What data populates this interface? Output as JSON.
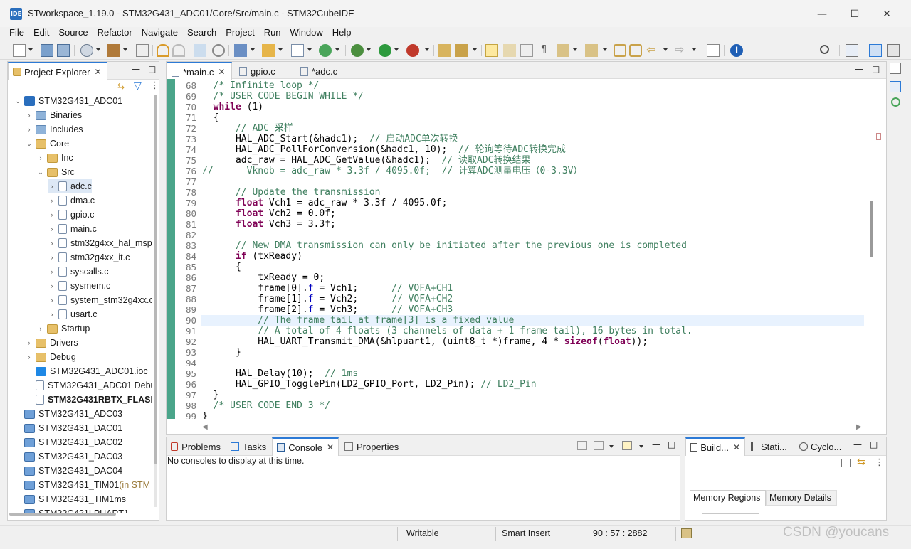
{
  "window": {
    "title": "STworkspace_1.19.0 - STM32G431_ADC01/Core/Src/main.c - STM32CubeIDE",
    "logo": "IDE"
  },
  "menu": [
    "File",
    "Edit",
    "Source",
    "Refactor",
    "Navigate",
    "Search",
    "Project",
    "Run",
    "Window",
    "Help"
  ],
  "explorer": {
    "tab": "Project Explorer",
    "rows": [
      {
        "label": "STM32G431_ADC01",
        "indent": 0,
        "chev": "v",
        "icon": "proj"
      },
      {
        "label": "Binaries",
        "indent": 1,
        "chev": ">",
        "icon": "blue"
      },
      {
        "label": "Includes",
        "indent": 1,
        "chev": ">",
        "icon": "blue"
      },
      {
        "label": "Core",
        "indent": 1,
        "chev": "v",
        "icon": "folder"
      },
      {
        "label": "Inc",
        "indent": 2,
        "chev": ">",
        "icon": "folder"
      },
      {
        "label": "Src",
        "indent": 2,
        "chev": "v",
        "icon": "folder"
      },
      {
        "label": "adc.c",
        "indent": 3,
        "chev": ">",
        "icon": "file",
        "selected": true
      },
      {
        "label": "dma.c",
        "indent": 3,
        "chev": ">",
        "icon": "file"
      },
      {
        "label": "gpio.c",
        "indent": 3,
        "chev": ">",
        "icon": "file"
      },
      {
        "label": "main.c",
        "indent": 3,
        "chev": ">",
        "icon": "file"
      },
      {
        "label": "stm32g4xx_hal_msp",
        "indent": 3,
        "chev": ">",
        "icon": "file"
      },
      {
        "label": "stm32g4xx_it.c",
        "indent": 3,
        "chev": ">",
        "icon": "file"
      },
      {
        "label": "syscalls.c",
        "indent": 3,
        "chev": ">",
        "icon": "file"
      },
      {
        "label": "sysmem.c",
        "indent": 3,
        "chev": ">",
        "icon": "file"
      },
      {
        "label": "system_stm32g4xx.c",
        "indent": 3,
        "chev": ">",
        "icon": "file"
      },
      {
        "label": "usart.c",
        "indent": 3,
        "chev": ">",
        "icon": "file"
      },
      {
        "label": "Startup",
        "indent": 2,
        "chev": ">",
        "icon": "folder"
      },
      {
        "label": "Drivers",
        "indent": 1,
        "chev": ">",
        "icon": "folder"
      },
      {
        "label": "Debug",
        "indent": 1,
        "chev": ">",
        "icon": "folder"
      },
      {
        "label": "STM32G431_ADC01.ioc",
        "indent": 1,
        "chev": "",
        "icon": "mx"
      },
      {
        "label": "STM32G431_ADC01 Debu",
        "indent": 1,
        "chev": "",
        "icon": "file"
      },
      {
        "label": "STM32G431RBTX_FLASH",
        "indent": 1,
        "chev": "",
        "icon": "file",
        "bold": true
      },
      {
        "label": "STM32G431_ADC03",
        "indent": 0,
        "chev": "",
        "icon": "proj2"
      },
      {
        "label": "STM32G431_DAC01",
        "indent": 0,
        "chev": "",
        "icon": "proj2"
      },
      {
        "label": "STM32G431_DAC02",
        "indent": 0,
        "chev": "",
        "icon": "proj2"
      },
      {
        "label": "STM32G431_DAC03",
        "indent": 0,
        "chev": "",
        "icon": "proj2"
      },
      {
        "label": "STM32G431_DAC04",
        "indent": 0,
        "chev": "",
        "icon": "proj2"
      },
      {
        "label": "STM32G431_TIM01",
        "indent": 0,
        "chev": "",
        "icon": "proj2",
        "suffix": " (in STM"
      },
      {
        "label": "STM32G431_TIM1ms",
        "indent": 0,
        "chev": "",
        "icon": "proj2"
      },
      {
        "label": "STM32G431LPUART1",
        "indent": 0,
        "chev": "",
        "icon": "proj2"
      }
    ]
  },
  "editor": {
    "tabs": [
      "*main.c",
      "gpio.c",
      "*adc.c"
    ],
    "lines": [
      {
        "n": "68",
        "t": [
          [
            "c",
            "  /* Infinite loop */"
          ]
        ]
      },
      {
        "n": "69",
        "t": [
          [
            "c",
            "  /* USER CODE BEGIN WHILE */"
          ]
        ]
      },
      {
        "n": "70",
        "t": [
          [
            "t",
            "  "
          ],
          [
            "k",
            "while"
          ],
          [
            "t",
            " (1)"
          ]
        ]
      },
      {
        "n": "71",
        "t": [
          [
            "t",
            "  {"
          ]
        ]
      },
      {
        "n": "72",
        "t": [
          [
            "c",
            "      // ADC 采样"
          ]
        ]
      },
      {
        "n": "73",
        "t": [
          [
            "t",
            "      HAL_ADC_Start(&hadc1);  "
          ],
          [
            "c",
            "// 启动ADC单次转换"
          ]
        ]
      },
      {
        "n": "74",
        "t": [
          [
            "t",
            "      HAL_ADC_PollForConversion(&hadc1, 10);  "
          ],
          [
            "c",
            "// 轮询等待ADC转换完成"
          ]
        ]
      },
      {
        "n": "75",
        "t": [
          [
            "t",
            "      adc_raw = HAL_ADC_GetValue(&hadc1);  "
          ],
          [
            "c",
            "// 读取ADC转换结果"
          ]
        ]
      },
      {
        "n": "76",
        "t": [
          [
            "c",
            "//      Vknob = adc_raw * 3.3f / 4095.0f;  // 计算ADC测量电压（0-3.3V）"
          ]
        ]
      },
      {
        "n": "77",
        "t": [
          [
            "t",
            ""
          ]
        ]
      },
      {
        "n": "78",
        "t": [
          [
            "c",
            "      // Update the transmission"
          ]
        ]
      },
      {
        "n": "79",
        "t": [
          [
            "t",
            "      "
          ],
          [
            "k",
            "float"
          ],
          [
            "t",
            " Vch1 = adc_raw * 3.3f / 4095.0f;"
          ]
        ]
      },
      {
        "n": "80",
        "t": [
          [
            "t",
            "      "
          ],
          [
            "k",
            "float"
          ],
          [
            "t",
            " Vch2 = 0.0f;"
          ]
        ]
      },
      {
        "n": "81",
        "t": [
          [
            "t",
            "      "
          ],
          [
            "k",
            "float"
          ],
          [
            "t",
            " Vch3 = 3.3f;"
          ]
        ]
      },
      {
        "n": "82",
        "t": [
          [
            "t",
            ""
          ]
        ]
      },
      {
        "n": "83",
        "t": [
          [
            "c",
            "      // New DMA transmission can only be initiated after the previous one is completed"
          ]
        ]
      },
      {
        "n": "84",
        "t": [
          [
            "t",
            "      "
          ],
          [
            "k",
            "if"
          ],
          [
            "t",
            " (txReady)"
          ]
        ]
      },
      {
        "n": "85",
        "t": [
          [
            "t",
            "      {"
          ]
        ]
      },
      {
        "n": "86",
        "t": [
          [
            "t",
            "          txReady = 0;"
          ]
        ]
      },
      {
        "n": "87",
        "t": [
          [
            "t",
            "          frame[0]."
          ],
          [
            "f",
            "f"
          ],
          [
            "t",
            " = Vch1;      "
          ],
          [
            "c",
            "// VOFA+CH1"
          ]
        ]
      },
      {
        "n": "88",
        "t": [
          [
            "t",
            "          frame[1]."
          ],
          [
            "f",
            "f"
          ],
          [
            "t",
            " = Vch2;      "
          ],
          [
            "c",
            "// VOFA+CH2"
          ]
        ]
      },
      {
        "n": "89",
        "t": [
          [
            "t",
            "          frame[2]."
          ],
          [
            "f",
            "f"
          ],
          [
            "t",
            " = Vch3;      "
          ],
          [
            "c",
            "// VOFA+CH3"
          ]
        ]
      },
      {
        "n": "90",
        "t": [
          [
            "c",
            "          // The frame tail at frame[3] is a fixed value"
          ]
        ],
        "hl": true
      },
      {
        "n": "91",
        "t": [
          [
            "c",
            "          // A total of 4 floats (3 channels of data + 1 frame tail), 16 bytes in total."
          ]
        ]
      },
      {
        "n": "92",
        "t": [
          [
            "t",
            "          HAL_UART_Transmit_DMA(&hlpuart1, (uint8_t *)frame, 4 * "
          ],
          [
            "k",
            "sizeof"
          ],
          [
            "t",
            "("
          ],
          [
            "k",
            "float"
          ],
          [
            "t",
            "));"
          ]
        ]
      },
      {
        "n": "93",
        "t": [
          [
            "t",
            "      }"
          ]
        ]
      },
      {
        "n": "94",
        "t": [
          [
            "t",
            ""
          ]
        ]
      },
      {
        "n": "95",
        "t": [
          [
            "t",
            "      HAL_Delay(10);  "
          ],
          [
            "c",
            "// 1ms"
          ]
        ]
      },
      {
        "n": "96",
        "t": [
          [
            "t",
            "      HAL_GPIO_TogglePin(LD2_GPIO_Port, LD2_Pin); "
          ],
          [
            "c",
            "// LD2_Pin"
          ]
        ]
      },
      {
        "n": "97",
        "t": [
          [
            "t",
            "  }"
          ]
        ]
      },
      {
        "n": "98",
        "t": [
          [
            "c",
            "  /* USER CODE END 3 */"
          ]
        ]
      },
      {
        "n": "99",
        "t": [
          [
            "t",
            "}"
          ]
        ]
      }
    ]
  },
  "console": {
    "tabs": [
      "Problems",
      "Tasks",
      "Console",
      "Properties"
    ],
    "message": "No consoles to display at this time."
  },
  "build": {
    "tabs": [
      "Build...",
      "Stati...",
      "Cyclo..."
    ],
    "subtabs": [
      "Memory Regions",
      "Memory Details"
    ]
  },
  "status": {
    "mode": "Writable",
    "insert": "Smart Insert",
    "position": "90 : 57 : 2882"
  },
  "watermark": "CSDN @youcans"
}
